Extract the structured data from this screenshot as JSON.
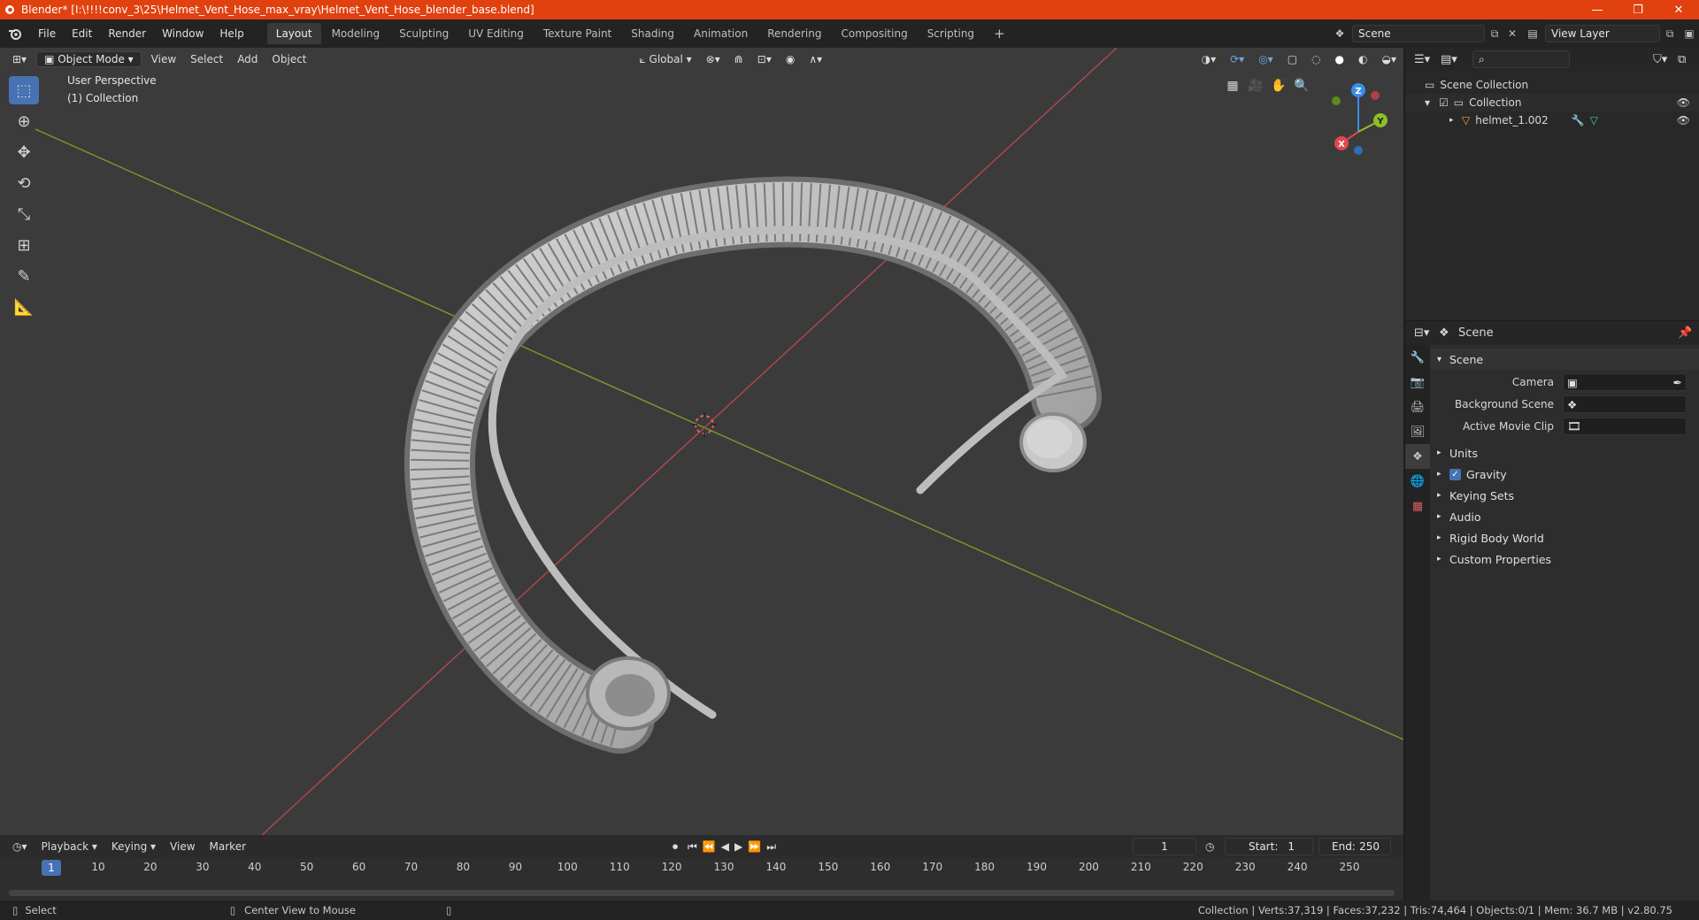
{
  "window": {
    "title": "Blender* [I:\\!!!!conv_3\\25\\Helmet_Vent_Hose_max_vray\\Helmet_Vent_Hose_blender_base.blend]",
    "minimize": "—",
    "restore": "❐",
    "close": "✕"
  },
  "menu": [
    "File",
    "Edit",
    "Render",
    "Window",
    "Help"
  ],
  "workspaces": [
    "Layout",
    "Modeling",
    "Sculpting",
    "UV Editing",
    "Texture Paint",
    "Shading",
    "Animation",
    "Rendering",
    "Compositing",
    "Scripting"
  ],
  "workspace_add": "+",
  "scene_field": "Scene",
  "viewlayer_field": "View Layer",
  "viewport": {
    "mode": "Object Mode",
    "menus": [
      "View",
      "Select",
      "Add",
      "Object"
    ],
    "orientation": "Global",
    "perspective_label": "User Perspective",
    "collection_label": "(1) Collection",
    "gizmo": {
      "x": "X",
      "y": "Y",
      "z": "Z"
    }
  },
  "outliner": {
    "search_placeholder": "",
    "scene_collection": "Scene Collection",
    "collection": "Collection",
    "object": "helmet_1.002"
  },
  "properties": {
    "context": "Scene",
    "panel_title": "Scene",
    "camera_label": "Camera",
    "background_scene_label": "Background Scene",
    "active_movie_clip_label": "Active Movie Clip",
    "sections": [
      "Units",
      "Gravity",
      "Keying Sets",
      "Audio",
      "Rigid Body World",
      "Custom Properties"
    ],
    "gravity_checked": true
  },
  "timeline": {
    "menus": [
      "Playback",
      "Keying",
      "View",
      "Marker"
    ],
    "current_frame": "1",
    "start_label": "Start:",
    "start_value": "1",
    "end_label": "End:",
    "end_value": "250",
    "ticks": [
      "1",
      "10",
      "20",
      "30",
      "40",
      "50",
      "60",
      "70",
      "80",
      "90",
      "100",
      "110",
      "120",
      "130",
      "140",
      "150",
      "160",
      "170",
      "180",
      "190",
      "200",
      "210",
      "220",
      "230",
      "240",
      "250"
    ]
  },
  "status": {
    "left_action": "Select",
    "middle_action": "Center View to Mouse",
    "stats": "Collection | Verts:37,319 | Faces:37,232 | Tris:74,464 | Objects:0/1 | Mem: 36.7 MB | v2.80.75"
  },
  "colors": {
    "title_bar": "#e0410f",
    "active_blue": "#4772b3",
    "x_axis": "#e0474d",
    "y_axis": "#8fbf24",
    "z_axis": "#3a8ee6"
  }
}
